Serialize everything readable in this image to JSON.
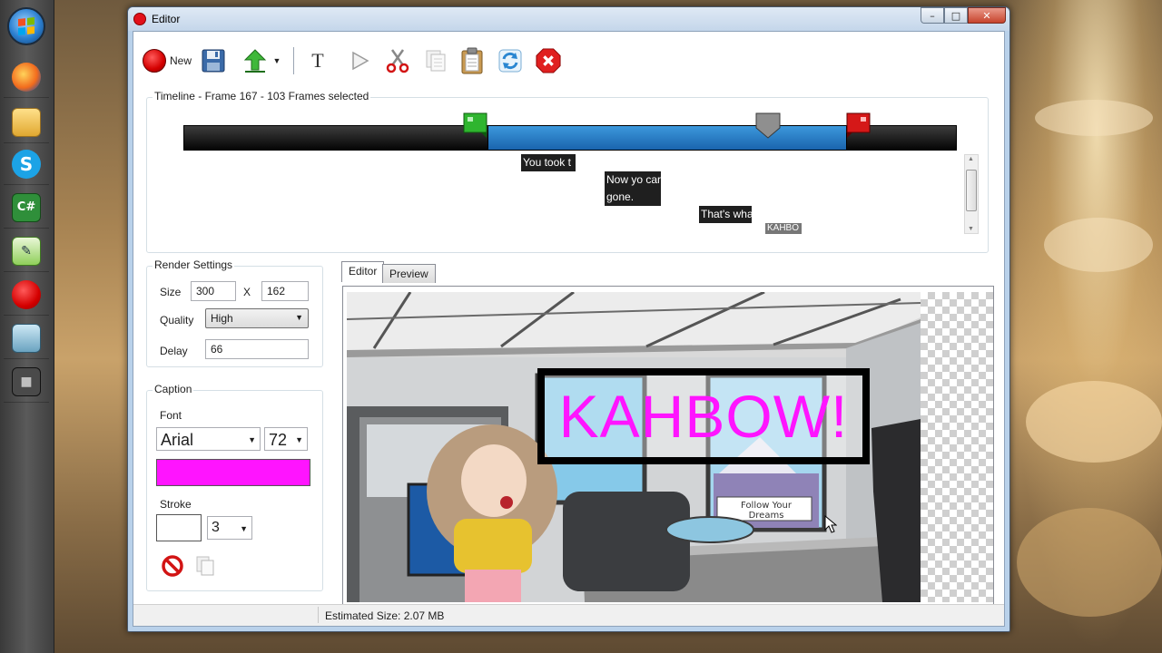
{
  "window": {
    "title": "Editor"
  },
  "toolbar": {
    "new_label": "New"
  },
  "timeline": {
    "title": "Timeline - Frame 167 - 103 Frames selected",
    "captions": [
      "You took t",
      "Now yo car",
      "gone.",
      "That's wha",
      "KAHBO"
    ]
  },
  "render_settings": {
    "title": "Render Settings",
    "size_label": "Size",
    "width": "300",
    "x_label": "X",
    "height": "162",
    "quality_label": "Quality",
    "quality_value": "High",
    "delay_label": "Delay",
    "delay_value": "66"
  },
  "caption": {
    "title": "Caption",
    "font_label": "Font",
    "font_value": "Arial",
    "font_size": "72",
    "stroke_label": "Stroke",
    "stroke_value": "3",
    "fill_color": "#ff14ff"
  },
  "tabs": {
    "editor": "Editor",
    "preview": "Preview"
  },
  "canvas": {
    "caption_text": "KAHBOW!",
    "sign_text": "Follow Your Dreams"
  },
  "status": {
    "estimated_size": "Estimated Size: 2.07 MB"
  },
  "colors": {
    "accent": "#1a64ad",
    "record_red": "#d40000",
    "caption_magenta": "#ff14ff",
    "start_marker": "#20b020",
    "end_marker": "#d01010"
  },
  "icons": {
    "toolbar": [
      "record-icon",
      "save-icon",
      "upload-arrow-icon",
      "dropdown-arrow-icon",
      "text-icon",
      "play-icon",
      "cut-icon",
      "copy-icon",
      "paste-icon",
      "refresh-icon",
      "close-red-icon"
    ],
    "taskbar": [
      "windows-start-icon",
      "firefox-icon",
      "file-manager-icon",
      "skype-icon",
      "csharp-icon",
      "notepad-icon",
      "recorder-icon",
      "display-icon",
      "camera-icon"
    ]
  }
}
